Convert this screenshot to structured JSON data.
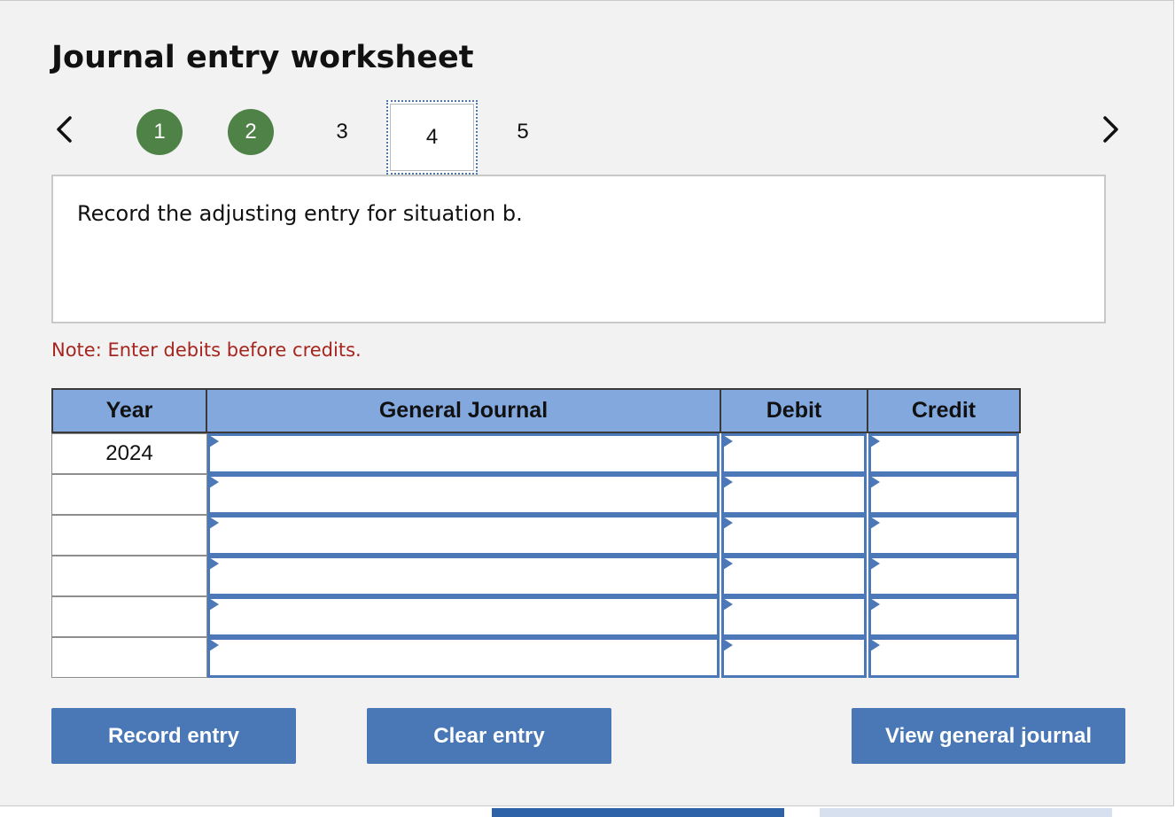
{
  "title": "Journal entry worksheet",
  "navigation": {
    "prev_icon": "chevron-left-icon",
    "next_icon": "chevron-right-icon",
    "steps": [
      {
        "label": "1",
        "state": "completed"
      },
      {
        "label": "2",
        "state": "completed"
      },
      {
        "label": "3",
        "state": "pending"
      },
      {
        "label": "4",
        "state": "current"
      },
      {
        "label": "5",
        "state": "pending"
      }
    ]
  },
  "prompt": "Record the adjusting entry for situation b.",
  "note": "Note: Enter debits before credits.",
  "journal": {
    "headers": {
      "year": "Year",
      "account": "General Journal",
      "debit": "Debit",
      "credit": "Credit"
    },
    "rows": [
      {
        "year": "2024",
        "account": "",
        "debit": "",
        "credit": ""
      },
      {
        "year": "",
        "account": "",
        "debit": "",
        "credit": ""
      },
      {
        "year": "",
        "account": "",
        "debit": "",
        "credit": ""
      },
      {
        "year": "",
        "account": "",
        "debit": "",
        "credit": ""
      },
      {
        "year": "",
        "account": "",
        "debit": "",
        "credit": ""
      },
      {
        "year": "",
        "account": "",
        "debit": "",
        "credit": ""
      }
    ]
  },
  "buttons": {
    "record": "Record entry",
    "clear": "Clear entry",
    "view": "View general journal"
  },
  "colors": {
    "completed_step": "#4e8247",
    "header_fill": "#82a8de",
    "button_fill": "#4a78b7",
    "note_text": "#a5261f",
    "input_border": "#4c78b8"
  }
}
